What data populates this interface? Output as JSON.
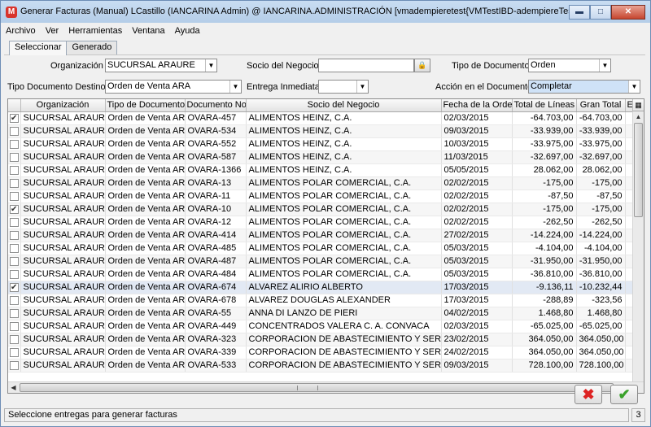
{
  "window": {
    "app_icon_letter": "M",
    "title": "Generar Facturas (Manual)  LCastillo (IANCARINA Admin) @ IANCARINA.ADMINISTRACIÓN [vmadempieretest{VMTestIBD-adempiereTest-adempiere}]",
    "min_label": "▬",
    "max_label": "□",
    "close_label": "✕"
  },
  "menu": [
    {
      "label": "Archivo"
    },
    {
      "label": "Ver"
    },
    {
      "label": "Herramientas"
    },
    {
      "label": "Ventana"
    },
    {
      "label": "Ayuda"
    }
  ],
  "tabs": [
    {
      "label": "Seleccionar",
      "active": true
    },
    {
      "label": "Generado",
      "active": false
    }
  ],
  "params": {
    "org_label": "Organización",
    "org_value": "SUCURSAL ARAURE",
    "partner_label": "Socio del Negocio",
    "partner_value": "",
    "doctype_label": "Tipo de Documento",
    "doctype_value": "Orden",
    "target_doctype_label": "Tipo Documento Destino",
    "target_doctype_value": "Orden de Venta ARA",
    "immediate_label": "Entrega Inmediata",
    "immediate_value": "",
    "docaction_label": "Acción en el Documento",
    "docaction_value": "Completar"
  },
  "table": {
    "columns": [
      "",
      "Organización",
      "Tipo de Documento",
      "Documento No.",
      "Socio del Negocio",
      "Fecha de la Orden",
      "Total de Líneas",
      "Gran Total",
      "E"
    ],
    "rows": [
      {
        "checked": true,
        "org": "SUCURSAL ARAURE",
        "doctype": "Orden de Venta ARA",
        "docno": "OVARA-457",
        "partner": "ALIMENTOS HEINZ,  C.A.",
        "date": "02/03/2015",
        "lines": "-64.703,00",
        "grand": "-64.703,00"
      },
      {
        "checked": false,
        "org": "SUCURSAL ARAURE",
        "doctype": "Orden de Venta ARA",
        "docno": "OVARA-534",
        "partner": "ALIMENTOS HEINZ,  C.A.",
        "date": "09/03/2015",
        "lines": "-33.939,00",
        "grand": "-33.939,00"
      },
      {
        "checked": false,
        "org": "SUCURSAL ARAURE",
        "doctype": "Orden de Venta ARA",
        "docno": "OVARA-552",
        "partner": "ALIMENTOS HEINZ,  C.A.",
        "date": "10/03/2015",
        "lines": "-33.975,00",
        "grand": "-33.975,00"
      },
      {
        "checked": false,
        "org": "SUCURSAL ARAURE",
        "doctype": "Orden de Venta ARA",
        "docno": "OVARA-587",
        "partner": "ALIMENTOS HEINZ,  C.A.",
        "date": "11/03/2015",
        "lines": "-32.697,00",
        "grand": "-32.697,00"
      },
      {
        "checked": false,
        "org": "SUCURSAL ARAURE",
        "doctype": "Orden de Venta ARA",
        "docno": "OVARA-1366",
        "partner": "ALIMENTOS HEINZ,  C.A.",
        "date": "05/05/2015",
        "lines": "28.062,00",
        "grand": "28.062,00"
      },
      {
        "checked": false,
        "org": "SUCURSAL ARAURE",
        "doctype": "Orden de Venta ARA",
        "docno": "OVARA-13",
        "partner": "ALIMENTOS POLAR COMERCIAL,  C.A.",
        "date": "02/02/2015",
        "lines": "-175,00",
        "grand": "-175,00"
      },
      {
        "checked": false,
        "org": "SUCURSAL ARAURE",
        "doctype": "Orden de Venta ARA",
        "docno": "OVARA-11",
        "partner": "ALIMENTOS POLAR COMERCIAL,  C.A.",
        "date": "02/02/2015",
        "lines": "-87,50",
        "grand": "-87,50"
      },
      {
        "checked": true,
        "org": "SUCURSAL ARAURE",
        "doctype": "Orden de Venta ARA",
        "docno": "OVARA-10",
        "partner": "ALIMENTOS POLAR COMERCIAL,  C.A.",
        "date": "02/02/2015",
        "lines": "-175,00",
        "grand": "-175,00"
      },
      {
        "checked": false,
        "org": "SUCURSAL ARAURE",
        "doctype": "Orden de Venta ARA",
        "docno": "OVARA-12",
        "partner": "ALIMENTOS POLAR COMERCIAL,  C.A.",
        "date": "02/02/2015",
        "lines": "-262,50",
        "grand": "-262,50"
      },
      {
        "checked": false,
        "org": "SUCURSAL ARAURE",
        "doctype": "Orden de Venta ARA",
        "docno": "OVARA-414",
        "partner": "ALIMENTOS POLAR COMERCIAL,  C.A.",
        "date": "27/02/2015",
        "lines": "-14.224,00",
        "grand": "-14.224,00"
      },
      {
        "checked": false,
        "org": "SUCURSAL ARAURE",
        "doctype": "Orden de Venta ARA",
        "docno": "OVARA-485",
        "partner": "ALIMENTOS POLAR COMERCIAL,  C.A.",
        "date": "05/03/2015",
        "lines": "-4.104,00",
        "grand": "-4.104,00"
      },
      {
        "checked": false,
        "org": "SUCURSAL ARAURE",
        "doctype": "Orden de Venta ARA",
        "docno": "OVARA-487",
        "partner": "ALIMENTOS POLAR COMERCIAL,  C.A.",
        "date": "05/03/2015",
        "lines": "-31.950,00",
        "grand": "-31.950,00"
      },
      {
        "checked": false,
        "org": "SUCURSAL ARAURE",
        "doctype": "Orden de Venta ARA",
        "docno": "OVARA-484",
        "partner": "ALIMENTOS POLAR COMERCIAL,  C.A.",
        "date": "05/03/2015",
        "lines": "-36.810,00",
        "grand": "-36.810,00"
      },
      {
        "checked": true,
        "org": "SUCURSAL ARAURE",
        "doctype": "Orden de Venta ARA",
        "docno": "OVARA-674",
        "partner": "ALVAREZ ALIRIO ALBERTO",
        "date": "17/03/2015",
        "lines": "-9.136,11",
        "grand": "-10.232,44",
        "selected": true
      },
      {
        "checked": false,
        "org": "SUCURSAL ARAURE",
        "doctype": "Orden de Venta ARA",
        "docno": "OVARA-678",
        "partner": "ALVAREZ DOUGLAS ALEXANDER",
        "date": "17/03/2015",
        "lines": "-288,89",
        "grand": "-323,56"
      },
      {
        "checked": false,
        "org": "SUCURSAL ARAURE",
        "doctype": "Orden de Venta ARA",
        "docno": "OVARA-55",
        "partner": "ANNA  DI LANZO DE PIERI",
        "date": "04/02/2015",
        "lines": "1.468,80",
        "grand": "1.468,80"
      },
      {
        "checked": false,
        "org": "SUCURSAL ARAURE",
        "doctype": "Orden de Venta ARA",
        "docno": "OVARA-449",
        "partner": "CONCENTRADOS VALERA C. A. CONVACA",
        "date": "02/03/2015",
        "lines": "-65.025,00",
        "grand": "-65.025,00"
      },
      {
        "checked": false,
        "org": "SUCURSAL ARAURE",
        "doctype": "Orden de Venta ARA",
        "docno": "OVARA-323",
        "partner": "CORPORACION DE ABASTECIMIENTO Y SERVICIO...",
        "date": "23/02/2015",
        "lines": "364.050,00",
        "grand": "364.050,00"
      },
      {
        "checked": false,
        "org": "SUCURSAL ARAURE",
        "doctype": "Orden de Venta ARA",
        "docno": "OVARA-339",
        "partner": "CORPORACION DE ABASTECIMIENTO Y SERVICIO...",
        "date": "24/02/2015",
        "lines": "364.050,00",
        "grand": "364.050,00"
      },
      {
        "checked": false,
        "org": "SUCURSAL ARAURE",
        "doctype": "Orden de Venta ARA",
        "docno": "OVARA-533",
        "partner": "CORPORACION DE ABASTECIMIENTO Y SERVICIO...",
        "date": "09/03/2015",
        "lines": "728.100,00",
        "grand": "728.100,00"
      }
    ]
  },
  "buttons": {
    "cancel_label": "✖",
    "ok_label": "✔"
  },
  "status": {
    "text": "Seleccione entregas para generar facturas",
    "count": "3"
  },
  "colors": {
    "title_bar": "#b4cde8",
    "close_button": "#c7462f",
    "selected_row": "#e2e9f4",
    "cancel_icon": "#dd2222",
    "ok_icon": "#3aa12a"
  }
}
